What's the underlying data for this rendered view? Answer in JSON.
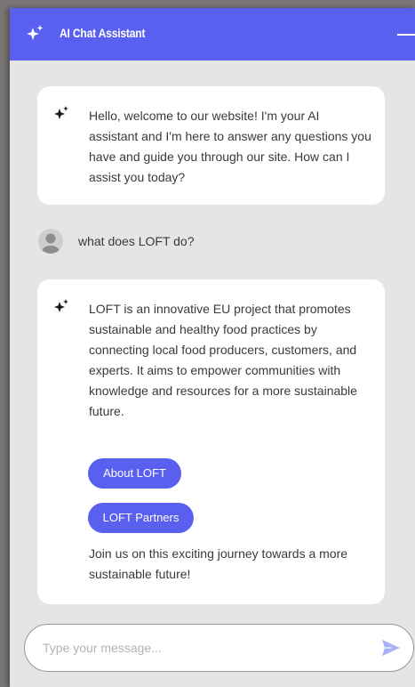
{
  "header": {
    "title": "AI Chat Assistant",
    "icon": "sparkle-icon",
    "minimize_icon": "minimize-icon",
    "background": "#5960f0"
  },
  "messages": {
    "bot_1": {
      "icon": "sparkle-icon",
      "text": "Hello, welcome to our website! I'm your AI assistant and I'm here to answer any questions you have and guide you through our site. How can I assist you today?"
    },
    "user_1": {
      "avatar": "user-avatar-icon",
      "text": "what does LOFT do?"
    },
    "bot_2": {
      "icon": "sparkle-icon",
      "text": "LOFT is an innovative EU project that promotes sustainable and healthy food practices by connecting local food producers, customers, and experts. It aims to empower communities with knowledge and resources for a more sustainable future.",
      "buttons": [
        "About LOFT",
        "LOFT Partners"
      ],
      "closing": "Join us on this exciting journey towards a more sustainable future!"
    }
  },
  "composer": {
    "placeholder": "Type your message...",
    "value": "",
    "send_icon": "send-icon"
  },
  "colors": {
    "accent": "#5960f0",
    "chat_background": "#e6e5e6",
    "bubble": "#ffffff",
    "text": "#3a3a3a"
  }
}
